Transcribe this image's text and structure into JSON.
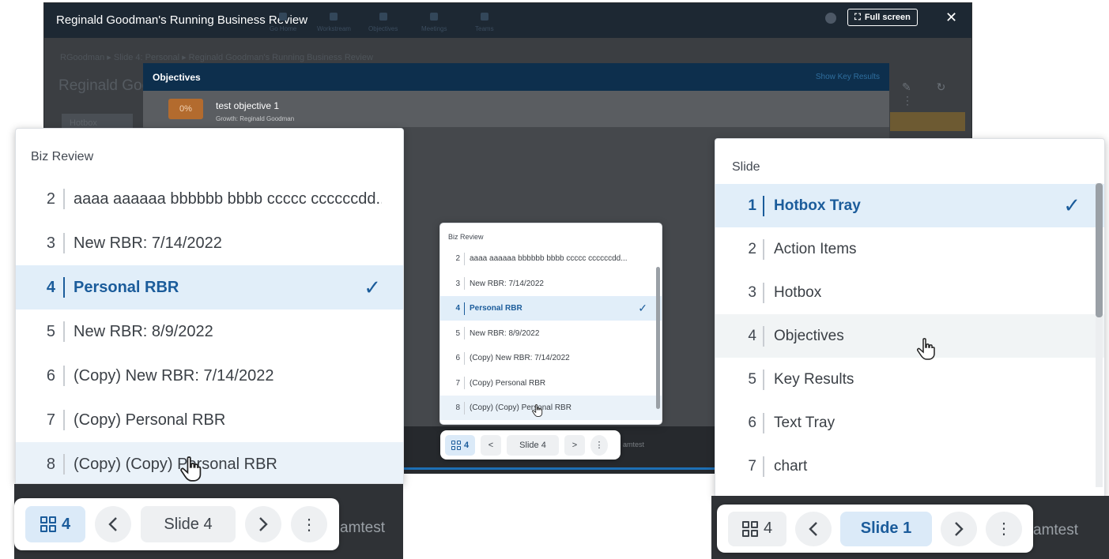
{
  "window": {
    "title": "Reginald Goodman's Running Business Review",
    "fullscreen_label": "Full screen",
    "close_glyph": "✕",
    "nav_ghost": [
      "Go Home",
      "Workstream",
      "Objectives",
      "Meetings",
      "Teams"
    ],
    "breadcrumb": "RGoodman ▸ Slide 4: Personal ▸ Reginald Goodman's Running Business Review",
    "heading": "Reginald Goo",
    "hotbox_label": "Hotbox"
  },
  "objectives_modal": {
    "title": "Objectives",
    "show_key_results": "Show Key Results",
    "objective": {
      "percent": "0%",
      "name": "test objective 1",
      "subtitle": "Growth: Reginald Goodman"
    }
  },
  "biz_review_list": {
    "header": "Biz Review",
    "items": [
      {
        "num": "2",
        "label": "aaaa aaaaaa bbbbbb bbbb ccccc ccccccdd..."
      },
      {
        "num": "3",
        "label": "New RBR: 7/14/2022"
      },
      {
        "num": "4",
        "label": "Personal RBR",
        "selected": true
      },
      {
        "num": "5",
        "label": "New RBR: 8/9/2022"
      },
      {
        "num": "6",
        "label": "(Copy) New RBR: 7/14/2022"
      },
      {
        "num": "7",
        "label": "(Copy) Personal RBR"
      },
      {
        "num": "8",
        "label": "(Copy) (Copy) Personal RBR",
        "hovered": true
      }
    ]
  },
  "slide_list": {
    "header": "Slide",
    "items": [
      {
        "num": "1",
        "label": "Hotbox Tray",
        "selected": true
      },
      {
        "num": "2",
        "label": "Action Items"
      },
      {
        "num": "3",
        "label": "Hotbox"
      },
      {
        "num": "4",
        "label": "Objectives",
        "hovered": true
      },
      {
        "num": "5",
        "label": "Key Results"
      },
      {
        "num": "6",
        "label": "Text Tray"
      },
      {
        "num": "7",
        "label": "chart"
      }
    ]
  },
  "toolbar_left": {
    "count": "4",
    "prev": "<",
    "slide": "Slide 4",
    "next": ">",
    "more": "⋮",
    "ghost": "amtest"
  },
  "toolbar_mid": {
    "count": "4",
    "prev": "<",
    "slide": "Slide 4",
    "next": ">",
    "more": "⋮",
    "ghost": "amtest"
  },
  "toolbar_right": {
    "count": "4",
    "prev": "<",
    "slide": "Slide 1",
    "next": ">",
    "more": "⋮",
    "ghost": "amtest"
  },
  "colors": {
    "accent": "#1b5c9b",
    "selected_row": "#e1eef9",
    "dark_header": "#1d2833",
    "objective_percent": "#b36b2e"
  },
  "icons": [
    "grid-icon",
    "chevron-left-icon",
    "chevron-right-icon",
    "more-vertical-icon",
    "check-icon",
    "hand-cursor-icon",
    "fullscreen-icon",
    "close-icon"
  ]
}
